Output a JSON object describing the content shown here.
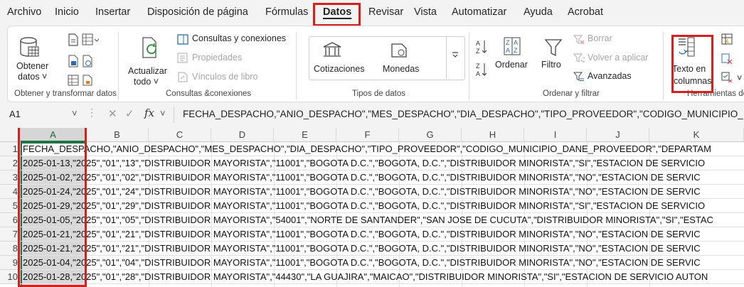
{
  "menu": {
    "tabs": [
      "Archivo",
      "Inicio",
      "Insertar",
      "Disposición de página",
      "Fórmulas",
      "Datos",
      "Revisar",
      "Vista",
      "Automatizar",
      "Ayuda",
      "Acrobat"
    ],
    "active": "Datos"
  },
  "ribbon": {
    "obtener": {
      "btn1": "Obtener",
      "btn2": "datos ˅",
      "group": "Obtener y transformar datos"
    },
    "consultas": {
      "actualizar1": "Actualizar",
      "actualizar2": "todo ˅",
      "consultas_conexiones": "Consultas y conexiones",
      "propiedades": "Propiedades",
      "vinculos": "Vínculos de libro",
      "group": "Consultas &conexiones"
    },
    "tipos": {
      "cotizaciones": "Cotizaciones",
      "monedas": "Monedas",
      "group": "Tipos de datos"
    },
    "ordenar": {
      "ordenar": "Ordenar",
      "filtro": "Filtro",
      "borrar": "Borrar",
      "volver": "Volver a aplicar",
      "avanzadas": "Avanzadas",
      "group": "Ordenar y filtrar"
    },
    "herramientas": {
      "texto1": "Texto en",
      "texto2": "columnas",
      "group": "Herramientas de"
    }
  },
  "formula_bar": {
    "cell_ref": "A1",
    "fx": "fx",
    "content": "FECHA_DESPACHO,\"ANIO_DESPACHO\",\"MES_DESPACHO\",\"DIA_DESPACHO\",\"TIPO_PROVEEDOR\",\"CODIGO_MUNICIPIO_"
  },
  "grid": {
    "columns": [
      "A",
      "B",
      "C",
      "D",
      "E",
      "F",
      "G",
      "H",
      "I",
      "J",
      "K"
    ],
    "rows": [
      {
        "n": "1",
        "text": "FECHA_DESPACHO,\"ANIO_DESPACHO\",\"MES_DESPACHO\",\"DIA_DESPACHO\",\"TIPO_PROVEEDOR\",\"CODIGO_MUNICIPIO_DANE_PROVEEDOR\",\"DEPARTAM"
      },
      {
        "n": "2",
        "text": "2025-01-13,\"2025\",\"01\",\"13\",\"DISTRIBUIDOR MAYORISTA\",\"11001\",\"BOGOTA D.C.\",\"BOGOTA, D.C.\",\"DISTRIBUIDOR MINORISTA\",\"SI\",\"ESTACION DE SERVICIO"
      },
      {
        "n": "3",
        "text": "2025-01-02,\"2025\",\"01\",\"02\",\"DISTRIBUIDOR MAYORISTA\",\"11001\",\"BOGOTA D.C.\",\"BOGOTA, D.C.\",\"DISTRIBUIDOR MINORISTA\",\"NO\",\"ESTACION DE SERVIC"
      },
      {
        "n": "4",
        "text": "2025-01-24,\"2025\",\"01\",\"24\",\"DISTRIBUIDOR MAYORISTA\",\"11001\",\"BOGOTA D.C.\",\"BOGOTA, D.C.\",\"DISTRIBUIDOR MINORISTA\",\"NO\",\"ESTACION DE SERVIC"
      },
      {
        "n": "5",
        "text": "2025-01-29,\"2025\",\"01\",\"29\",\"DISTRIBUIDOR MAYORISTA\",\"11001\",\"BOGOTA D.C.\",\"BOGOTA, D.C.\",\"DISTRIBUIDOR MINORISTA\",\"SI\",\"ESTACION DE SERVICIO"
      },
      {
        "n": "6",
        "text": "2025-01-05,\"2025\",\"01\",\"05\",\"DISTRIBUIDOR MAYORISTA\",\"54001\",\"NORTE DE SANTANDER\",\"SAN JOSE DE CUCUTA\",\"DISTRIBUIDOR MINORISTA\",\"SI\",\"ESTAC"
      },
      {
        "n": "7",
        "text": "2025-01-21,\"2025\",\"01\",\"21\",\"DISTRIBUIDOR MAYORISTA\",\"11001\",\"BOGOTA D.C.\",\"BOGOTA, D.C.\",\"DISTRIBUIDOR MINORISTA\",\"NO\",\"ESTACION DE SERVIC"
      },
      {
        "n": "8",
        "text": "2025-01-21,\"2025\",\"01\",\"21\",\"DISTRIBUIDOR MAYORISTA\",\"11001\",\"BOGOTA D.C.\",\"BOGOTA, D.C.\",\"DISTRIBUIDOR MINORISTA\",\"NO\",\"ESTACION DE SERVIC"
      },
      {
        "n": "9",
        "text": "2025-01-04,\"2025\",\"01\",\"04\",\"DISTRIBUIDOR MAYORISTA\",\"11001\",\"BOGOTA D.C.\",\"BOGOTA, D.C.\",\"DISTRIBUIDOR MINORISTA\",\"NO\",\"ESTACION DE SERVIC"
      },
      {
        "n": "10",
        "text": "2025-01-28,\"2025\",\"01\",\"28\",\"DISTRIBUIDOR MAYORISTA\",\"44430\",\"LA GUAJIRA\",\"MAICAO\",\"DISTRIBUIDOR MINORISTA\",\"SI\",\"ESTACION DE SERVICIO AUTON"
      }
    ]
  },
  "colors": {
    "highlight": "#d42020",
    "selection": "#217346"
  }
}
